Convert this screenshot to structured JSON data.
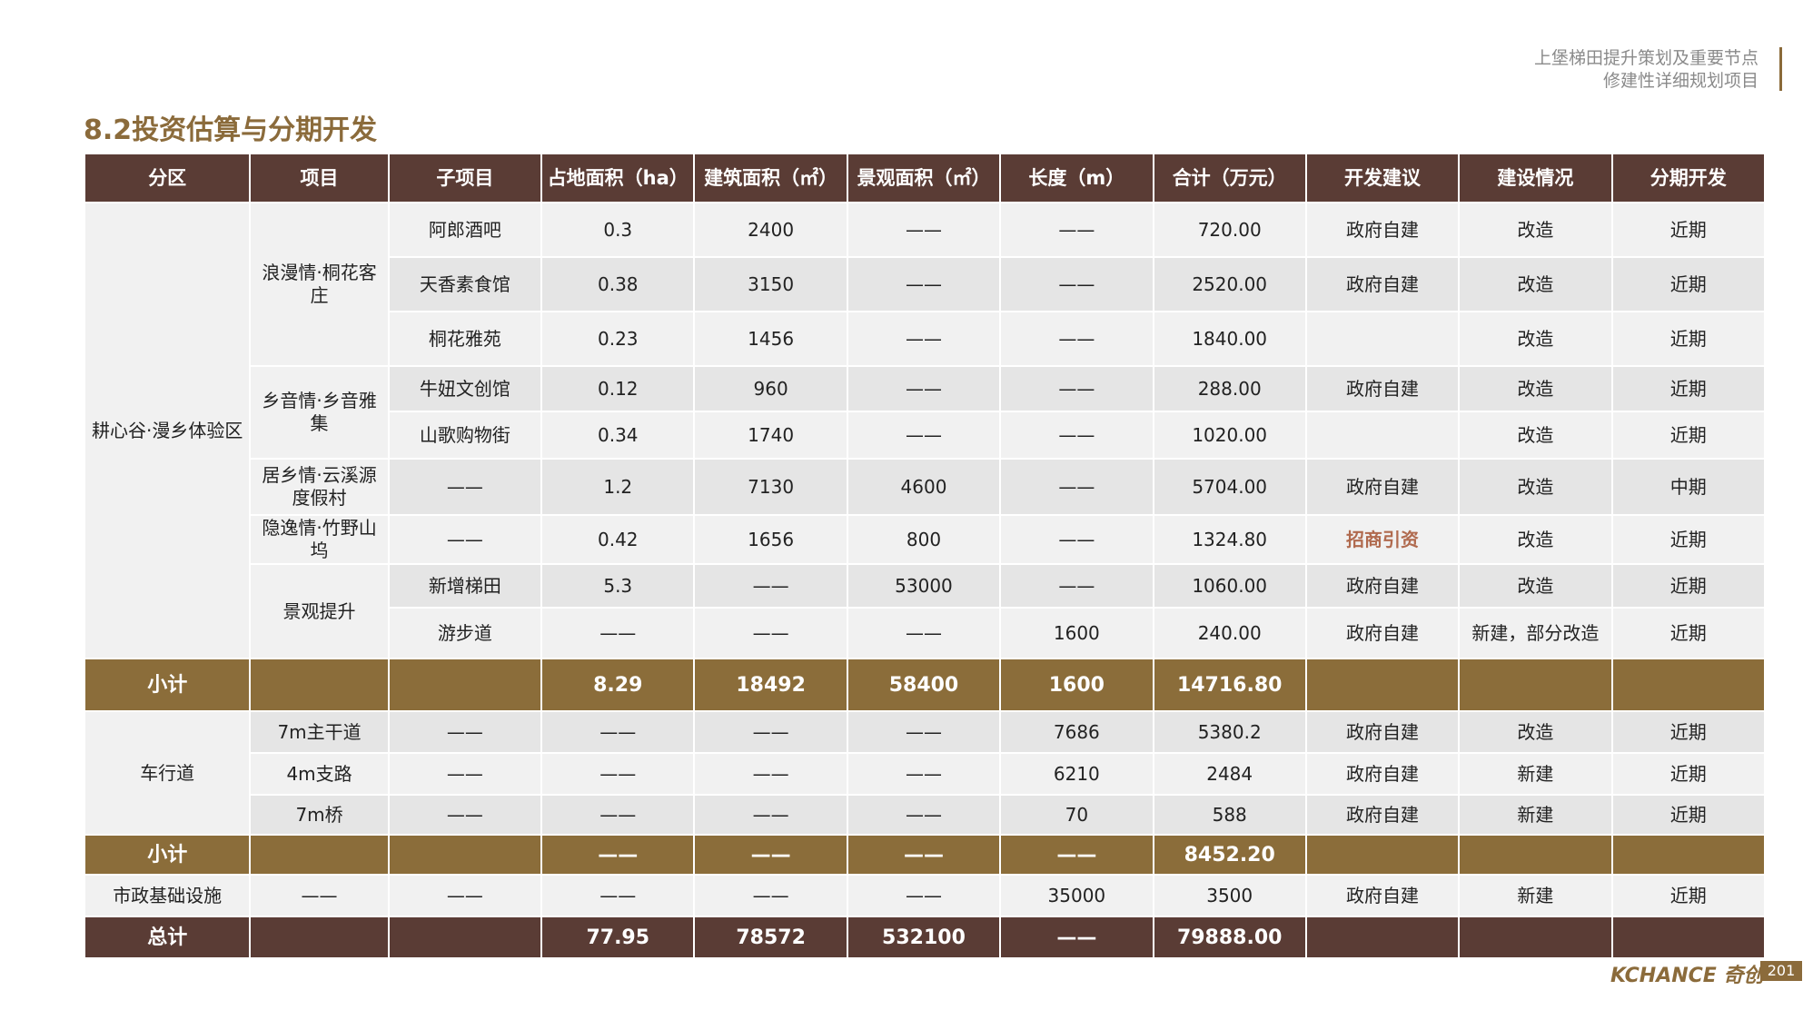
{
  "header": {
    "line1": "上堡梯田提升策划及重要节点",
    "line2": "修建性详细规划项目"
  },
  "title": "8.2投资估算与分期开发",
  "columns": [
    "分区",
    "项目",
    "子项目",
    "占地面积（ha）",
    "建筑面积（㎡）",
    "景观面积（㎡）",
    "长度（m）",
    "合计（万元）",
    "开发建议",
    "建设情况",
    "分期开发"
  ],
  "zone1": {
    "name": "耕心谷·漫乡体验区",
    "projects": [
      {
        "name": "浪漫情·桐花客庄"
      },
      {
        "name": "乡音情·乡音雅集"
      },
      {
        "name": "居乡情·云溪源度假村"
      },
      {
        "name": "隐逸情·竹野山坞"
      },
      {
        "name": "景观提升"
      }
    ],
    "rows": [
      [
        "阿郎酒吧",
        "0.3",
        "2400",
        "——",
        "——",
        "720.00",
        "政府自建",
        "改造",
        "近期"
      ],
      [
        "天香素食馆",
        "0.38",
        "3150",
        "——",
        "——",
        "2520.00",
        "政府自建",
        "改造",
        "近期"
      ],
      [
        "桐花雅苑",
        "0.23",
        "1456",
        "——",
        "——",
        "1840.00",
        "",
        "改造",
        "近期"
      ],
      [
        "牛妞文创馆",
        "0.12",
        "960",
        "——",
        "——",
        "288.00",
        "政府自建",
        "改造",
        "近期"
      ],
      [
        "山歌购物街",
        "0.34",
        "1740",
        "——",
        "——",
        "1020.00",
        "",
        "改造",
        "近期"
      ],
      [
        "——",
        "1.2",
        "7130",
        "4600",
        "——",
        "5704.00",
        "政府自建",
        "改造",
        "中期"
      ],
      [
        "——",
        "0.42",
        "1656",
        "800",
        "——",
        "1324.80",
        "招商引资",
        "改造",
        "近期"
      ],
      [
        "新增梯田",
        "5.3",
        "——",
        "53000",
        "——",
        "1060.00",
        "政府自建",
        "改造",
        "近期"
      ],
      [
        "游步道",
        "——",
        "——",
        "——",
        "1600",
        "240.00",
        "政府自建",
        "新建，部分改造",
        "近期"
      ]
    ]
  },
  "subtotal1": {
    "label": "小计",
    "values": [
      "8.29",
      "18492",
      "58400",
      "1600",
      "14716.80"
    ]
  },
  "zone2": {
    "name": "车行道",
    "rows": [
      [
        "7m主干道",
        "——",
        "——",
        "——",
        "——",
        "7686",
        "5380.2",
        "政府自建",
        "改造",
        "近期"
      ],
      [
        "4m支路",
        "——",
        "——",
        "——",
        "——",
        "6210",
        "2484",
        "政府自建",
        "新建",
        "近期"
      ],
      [
        "7m桥",
        "——",
        "——",
        "——",
        "——",
        "70",
        "588",
        "政府自建",
        "新建",
        "近期"
      ]
    ]
  },
  "subtotal2": {
    "label": "小计",
    "values": [
      "——",
      "——",
      "——",
      "——",
      "8452.20"
    ]
  },
  "municipal": [
    "市政基础设施",
    "——",
    "——",
    "——",
    "——",
    "——",
    "35000",
    "3500",
    "政府自建",
    "新建",
    "近期"
  ],
  "total": {
    "label": "总计",
    "values": [
      "77.95",
      "78572",
      "532100",
      "——",
      "79888.00"
    ]
  },
  "footer": {
    "logo": "KCHANCE 奇创",
    "page": "201"
  }
}
